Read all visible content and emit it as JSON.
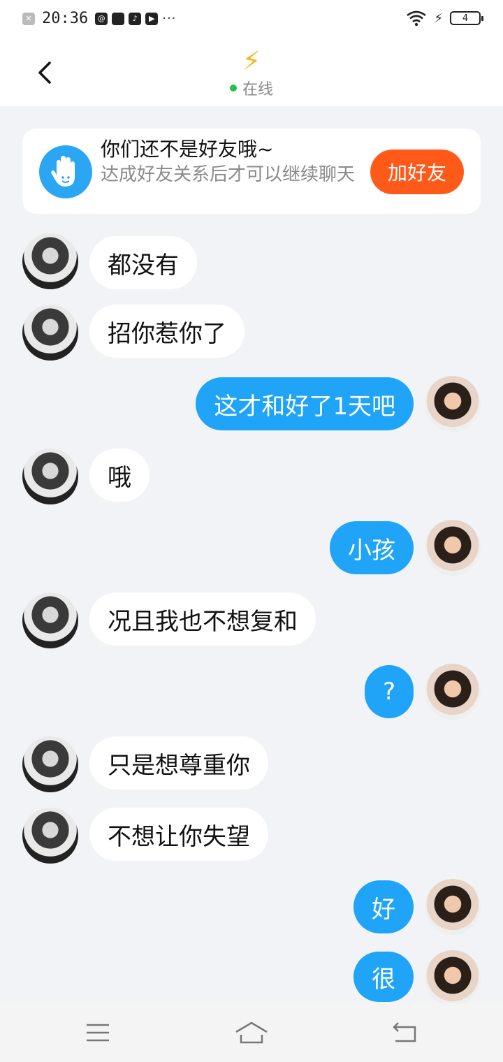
{
  "status_bar": {
    "time": "20:36",
    "battery": "4"
  },
  "header": {
    "title_icon": "lightning-bolt-icon",
    "status": "在线"
  },
  "friend_card": {
    "title": "你们还不是好友哦~",
    "subtitle": "达成好友关系后才可以继续聊天",
    "button": "加好友"
  },
  "messages": [
    {
      "side": "left",
      "text": "都没有"
    },
    {
      "side": "left",
      "text": "招你惹你了"
    },
    {
      "side": "right",
      "text": "这才和好了1天吧"
    },
    {
      "side": "left",
      "text": "哦"
    },
    {
      "side": "right",
      "text": "小孩"
    },
    {
      "side": "left",
      "text": "况且我也不想复和"
    },
    {
      "side": "right",
      "text": "?"
    },
    {
      "side": "left",
      "text": "只是想尊重你"
    },
    {
      "side": "left",
      "text": "不想让你失望"
    },
    {
      "side": "right",
      "text": "好"
    },
    {
      "side": "right",
      "text": "很"
    }
  ],
  "colors": {
    "accent_blue": "#1fa4f7",
    "add_friend_orange": "#ff5a1a",
    "online_green": "#21c24a"
  }
}
